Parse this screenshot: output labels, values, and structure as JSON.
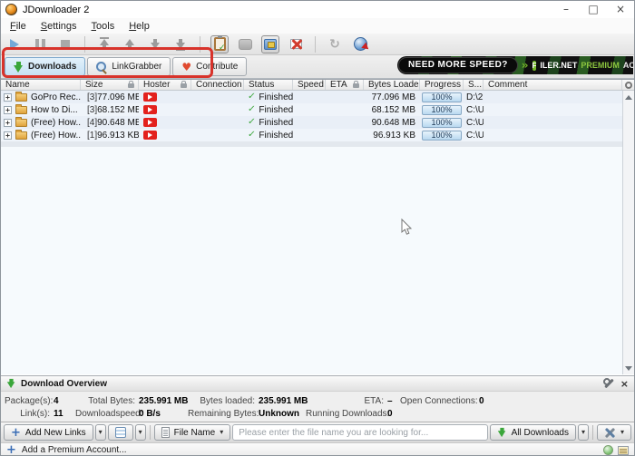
{
  "window": {
    "title": "JDownloader 2"
  },
  "icons": {
    "minimize": "–",
    "maximize": "□",
    "close": "×",
    "check": "✓",
    "heart": "♥",
    "plus": "+",
    "expand": "+",
    "reconnect": "↻",
    "dropdown": "▾",
    "chevrons": "»",
    "panel_close": "×"
  },
  "menu": {
    "items": [
      "File",
      "Settings",
      "Tools",
      "Help"
    ]
  },
  "tabs": {
    "downloads": "Downloads",
    "linkgrabber": "LinkGrabber",
    "contribute": "Contribute"
  },
  "banner": {
    "question": "NEED MORE SPEED?",
    "f": "F",
    "brand": "ILER.NET",
    "premium": "PREMIUM",
    "account": "ACCOUNT!"
  },
  "table": {
    "columns": {
      "name": "Name",
      "size": "Size",
      "hoster": "Hoster",
      "connection": "Connection",
      "status": "Status",
      "speed": "Speed",
      "eta": "ETA",
      "bytes": "Bytes Loaded",
      "progress": "Progress",
      "s": "S...",
      "comment": "Comment"
    },
    "rows": [
      {
        "name": "GoPro Rec...",
        "links": "[3]",
        "size": "77.096 MB",
        "status": "Finished",
        "bytes": "77.096 MB",
        "progress": "100%",
        "save_to": "D:\\2..."
      },
      {
        "name": "How to Di...",
        "links": "[3]",
        "size": "68.152 MB",
        "status": "Finished",
        "bytes": "68.152 MB",
        "progress": "100%",
        "save_to": "C:\\U..."
      },
      {
        "name": "(Free) How...",
        "links": "[4]",
        "size": "90.648 MB",
        "status": "Finished",
        "bytes": "90.648 MB",
        "progress": "100%",
        "save_to": "C:\\U..."
      },
      {
        "name": "(Free) How...",
        "links": "[1]",
        "size": "96.913 KB",
        "status": "Finished",
        "bytes": "96.913 KB",
        "progress": "100%",
        "save_to": "C:\\U..."
      }
    ]
  },
  "overview": {
    "title": "Download Overview",
    "row1": [
      {
        "label": "Package(s):",
        "value": "4"
      },
      {
        "label": "Total Bytes:",
        "value": "235.991 MB"
      },
      {
        "label": "Bytes loaded:",
        "value": "235.991 MB"
      },
      {
        "label": "ETA:",
        "value": "–"
      },
      {
        "label": "Open Connections:",
        "value": "0"
      }
    ],
    "row2": [
      {
        "label": "Link(s):",
        "value": "11"
      },
      {
        "label": "Downloadspeed:",
        "value": "0 B/s"
      },
      {
        "label": "Remaining Bytes:",
        "value": "Unknown"
      },
      {
        "label": "Running Downloads:",
        "value": "0"
      }
    ]
  },
  "bottombar": {
    "add_new_links": "Add New Links",
    "file_name": "File Name",
    "search_placeholder": "Please enter the file name you are looking for...",
    "all_downloads": "All Downloads"
  },
  "statusbar": {
    "add_premium": "Add a Premium Account..."
  },
  "colors": {
    "accent_green": "#3aa63a",
    "youtube_red": "#e3211d",
    "annotation_red": "#d8332b",
    "tab_active_bg": "#cfe6f7",
    "banner_green": "#76b82a"
  }
}
